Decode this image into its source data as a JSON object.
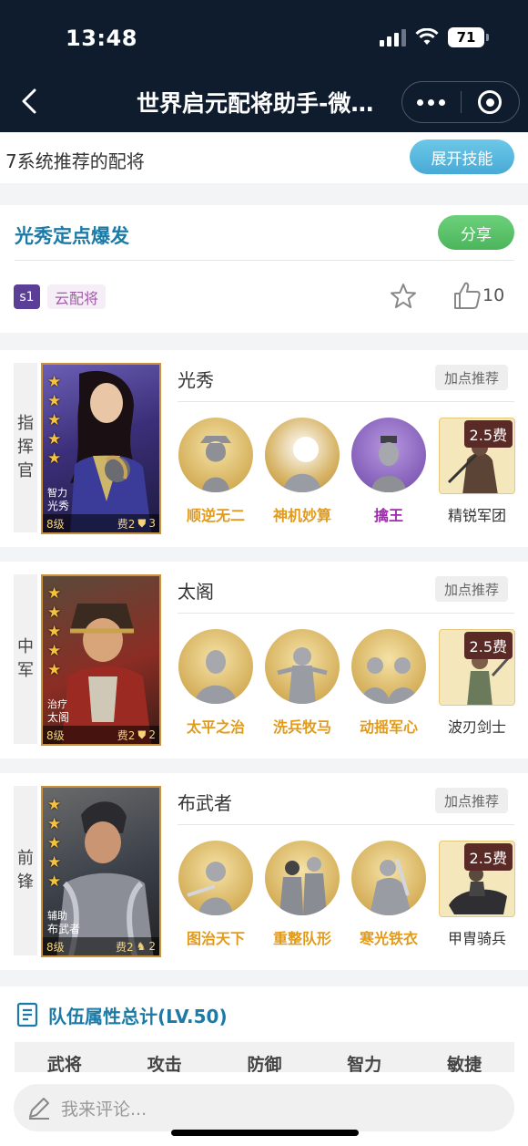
{
  "status": {
    "time": "13:48",
    "battery": "71"
  },
  "nav": {
    "title": "世界启元配将助手-微…"
  },
  "system": {
    "label": "7系统推荐的配将",
    "expand_label": "展开技能"
  },
  "lineup": {
    "name": "光秀定点爆发",
    "share_label": "分享",
    "season": "s1",
    "tag": "云配将",
    "likes": "10"
  },
  "heroes": [
    {
      "role": [
        "指",
        "挥",
        "官"
      ],
      "name": "光秀",
      "portrait_type": "智力",
      "portrait_name": "光秀",
      "level": "8级",
      "cost": "费2",
      "unit_count": "3",
      "addpoint_label": "加点推荐",
      "skills": [
        {
          "label": "顺逆无二",
          "color": "#e29a1a"
        },
        {
          "label": "神机妙算",
          "color": "#e29a1a"
        },
        {
          "label": "擒王",
          "color": "#a12bb0"
        }
      ],
      "troop": {
        "label": "精锐军团",
        "cost": "2.5费"
      }
    },
    {
      "role": [
        "中",
        "军"
      ],
      "name": "太阁",
      "portrait_type": "治疗",
      "portrait_name": "太阁",
      "level": "8级",
      "cost": "费2",
      "unit_count": "2",
      "addpoint_label": "加点推荐",
      "skills": [
        {
          "label": "太平之治",
          "color": "#e29a1a"
        },
        {
          "label": "洗兵牧马",
          "color": "#e29a1a"
        },
        {
          "label": "动摇军心",
          "color": "#e29a1a"
        }
      ],
      "troop": {
        "label": "波刃剑士",
        "cost": "2.5费"
      }
    },
    {
      "role": [
        "前",
        "锋"
      ],
      "name": "布武者",
      "portrait_type": "辅助",
      "portrait_name": "布武者",
      "level": "8级",
      "cost": "费2",
      "unit_count": "2",
      "addpoint_label": "加点推荐",
      "skills": [
        {
          "label": "图治天下",
          "color": "#e29a1a"
        },
        {
          "label": "重整队形",
          "color": "#e29a1a"
        },
        {
          "label": "寒光铁衣",
          "color": "#e29a1a"
        }
      ],
      "troop": {
        "label": "甲胄骑兵",
        "cost": "2.5费"
      }
    }
  ],
  "totals": {
    "title": "队伍属性总计(LV.50)",
    "columns": [
      "武将",
      "攻击",
      "防御",
      "智力",
      "敏捷"
    ]
  },
  "comment": {
    "placeholder": "我来评论..."
  }
}
